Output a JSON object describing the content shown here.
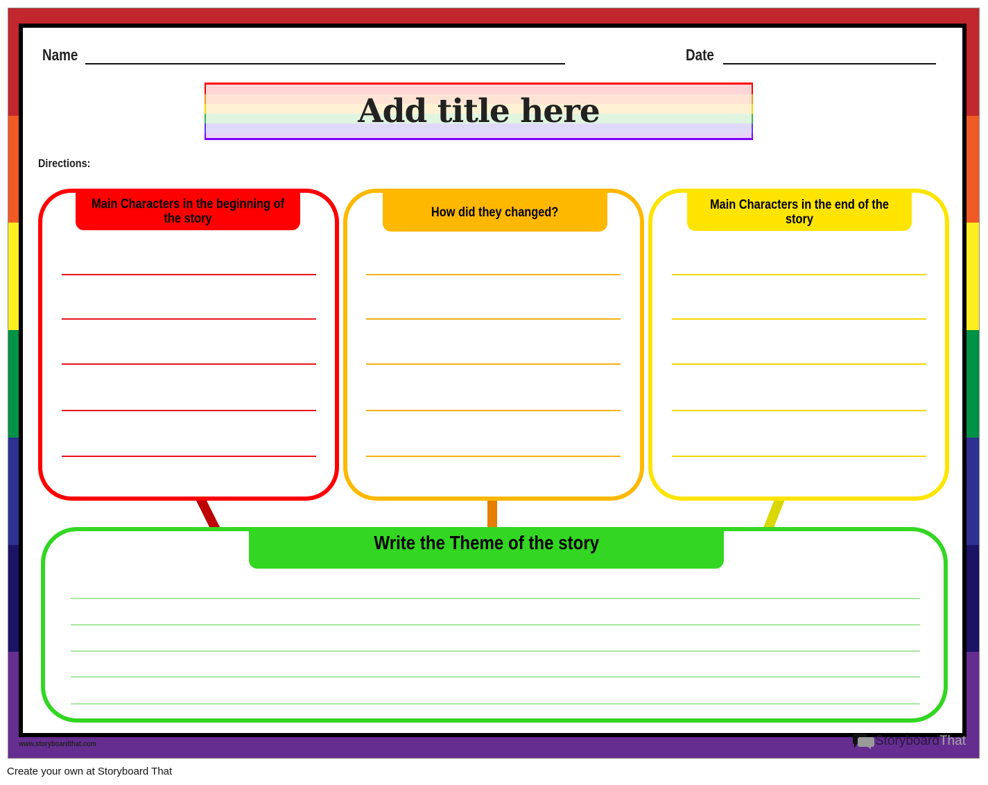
{
  "worksheet": {
    "name_label": "Name",
    "date_label": "Date",
    "title": "Add title here",
    "directions_label": "Directions:",
    "border_colors": [
      "#c1272d",
      "#f15a24",
      "#fcee21",
      "#009245",
      "#2e3192",
      "#1b1464",
      "#662d91"
    ],
    "title_band_colors": [
      "#ffd6d8",
      "#ffe4d6",
      "#fff2d4",
      "#e0f5e0",
      "#e0dafa",
      "#e8d4f8"
    ],
    "boxes": [
      {
        "header": "Main Characters in the beginning of the story",
        "color": "#ff0000",
        "line_color": "#e8141c",
        "line_count": 5
      },
      {
        "header": "How did they changed?",
        "color": "#ffb800",
        "line_color": "#f5b014",
        "line_count": 5
      },
      {
        "header": "Main Characters in the end of the story",
        "color": "#ffe400",
        "line_color": "#f2d800",
        "line_count": 5
      }
    ],
    "theme_box": {
      "header": "Write the Theme of the story",
      "color": "#33d622",
      "line_color": "#a8e8a0",
      "line_count": 5
    },
    "connector_colors": [
      "#bd0000",
      "#e67e00",
      "#d8d800"
    ]
  },
  "footer": {
    "url": "www.storyboardthat.com",
    "brand_part1": "Storyboard",
    "brand_part2": "That",
    "brand_icon": "speech-bubbles-icon",
    "create_own": "Create your own at Storyboard That"
  }
}
